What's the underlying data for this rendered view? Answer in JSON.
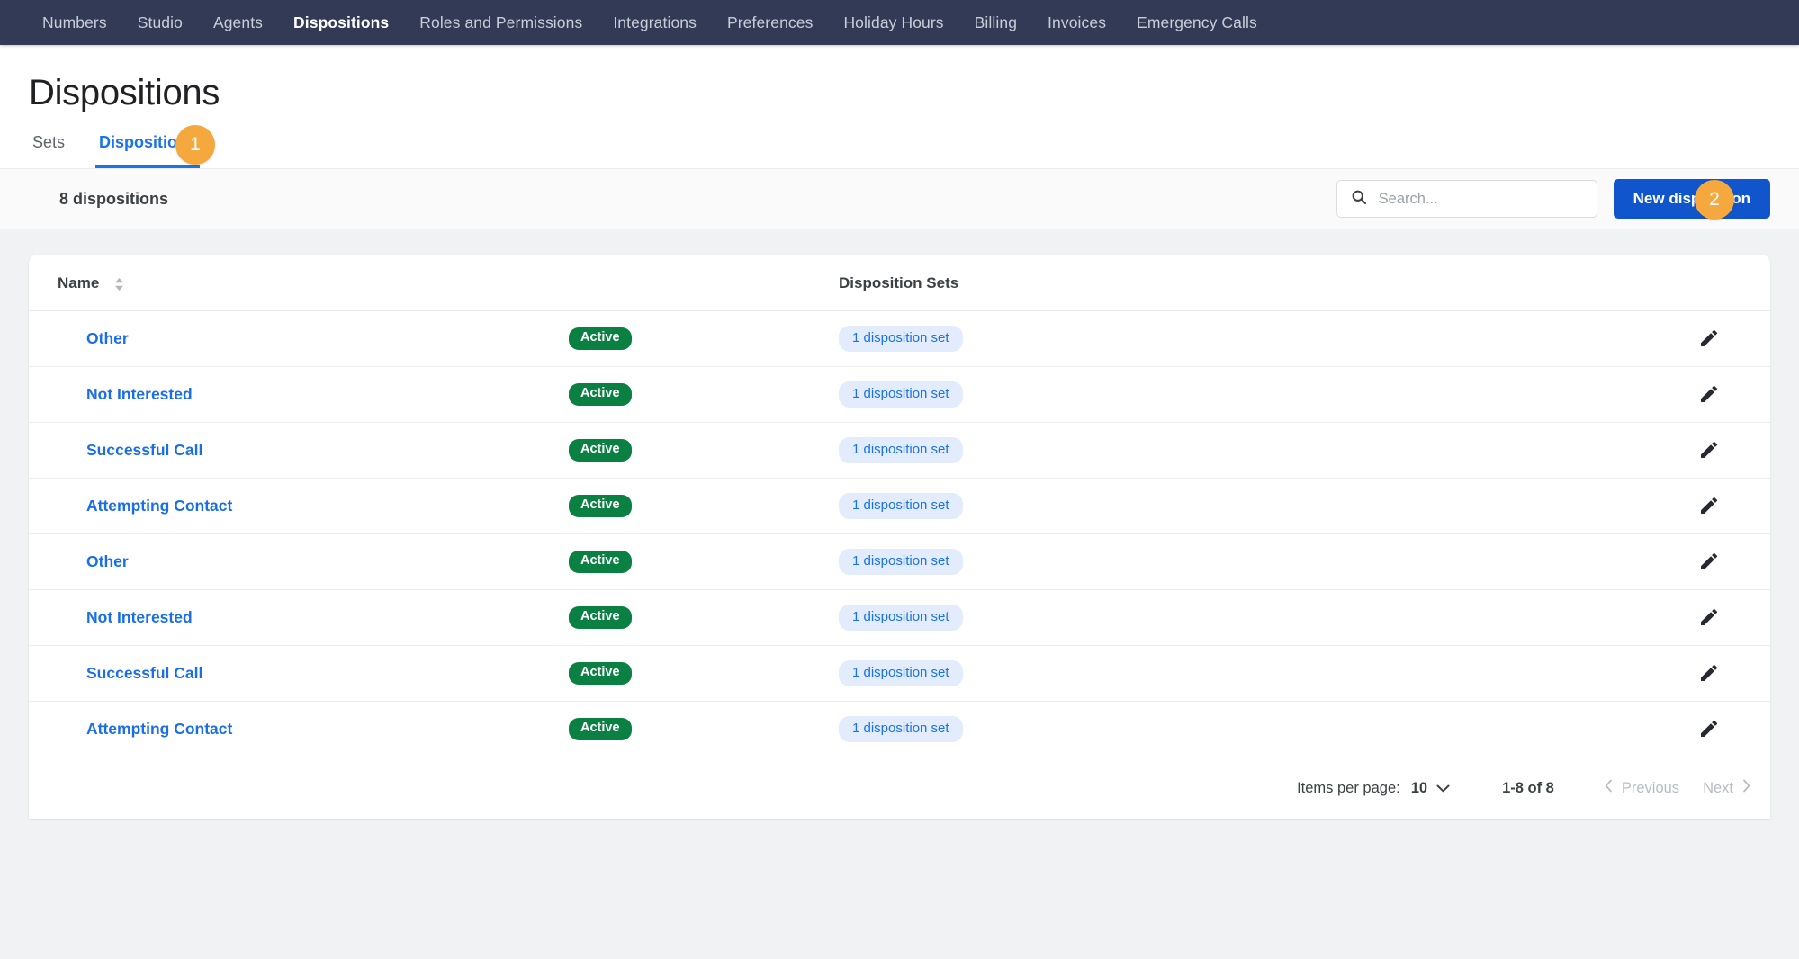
{
  "topnav": {
    "items": [
      {
        "label": "Numbers",
        "active": false
      },
      {
        "label": "Studio",
        "active": false
      },
      {
        "label": "Agents",
        "active": false
      },
      {
        "label": "Dispositions",
        "active": true
      },
      {
        "label": "Roles and Permissions",
        "active": false
      },
      {
        "label": "Integrations",
        "active": false
      },
      {
        "label": "Preferences",
        "active": false
      },
      {
        "label": "Holiday Hours",
        "active": false
      },
      {
        "label": "Billing",
        "active": false
      },
      {
        "label": "Invoices",
        "active": false
      },
      {
        "label": "Emergency Calls",
        "active": false
      }
    ]
  },
  "header": {
    "title": "Dispositions",
    "tabs": [
      {
        "label": "Sets",
        "active": false
      },
      {
        "label": "Dispositions",
        "active": true
      }
    ]
  },
  "annotations": [
    {
      "label": "1",
      "target": "tab-dispositions",
      "color": "#f5a83d"
    },
    {
      "label": "2",
      "target": "new-disposition-button",
      "color": "#f5a83d"
    }
  ],
  "toolbar": {
    "count_label": "8 dispositions",
    "search_placeholder": "Search...",
    "search_value": "",
    "search_icon": "search-icon",
    "new_button_label": "New disposition"
  },
  "table": {
    "columns": [
      {
        "label": "Name",
        "sortable": true,
        "sort_icon": "sort-updown-icon"
      },
      {
        "label": "",
        "sortable": false
      },
      {
        "label": "Disposition Sets",
        "sortable": false
      },
      {
        "label": "",
        "sortable": false
      }
    ],
    "rows": [
      {
        "name": "Other",
        "status": "Active",
        "sets": "1 disposition set",
        "action_icon": "pencil-icon"
      },
      {
        "name": "Not Interested",
        "status": "Active",
        "sets": "1 disposition set",
        "action_icon": "pencil-icon"
      },
      {
        "name": "Successful Call",
        "status": "Active",
        "sets": "1 disposition set",
        "action_icon": "pencil-icon"
      },
      {
        "name": "Attempting Contact",
        "status": "Active",
        "sets": "1 disposition set",
        "action_icon": "pencil-icon"
      },
      {
        "name": "Other",
        "status": "Active",
        "sets": "1 disposition set",
        "action_icon": "pencil-icon"
      },
      {
        "name": "Not Interested",
        "status": "Active",
        "sets": "1 disposition set",
        "action_icon": "pencil-icon"
      },
      {
        "name": "Successful Call",
        "status": "Active",
        "sets": "1 disposition set",
        "action_icon": "pencil-icon"
      },
      {
        "name": "Attempting Contact",
        "status": "Active",
        "sets": "1 disposition set",
        "action_icon": "pencil-icon"
      }
    ]
  },
  "paginator": {
    "items_per_page_label": "Items per page:",
    "items_per_page_value": "10",
    "range_label": "1-8 of 8",
    "previous_label": "Previous",
    "next_label": "Next"
  },
  "colors": {
    "nav_bg": "#323a56",
    "accent_blue": "#1a73e8",
    "primary_button": "#1155cc",
    "status_green": "#0b8043",
    "chip_bg": "#e3ecfd",
    "annotation_orange": "#f5a83d",
    "page_bg": "#f1f2f4"
  }
}
